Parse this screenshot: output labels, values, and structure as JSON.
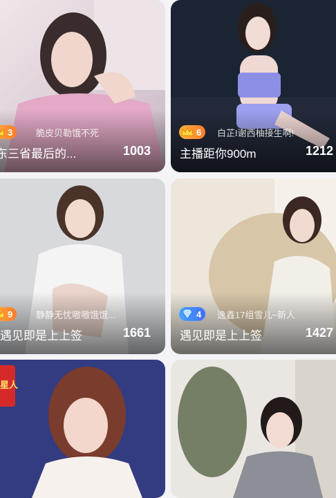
{
  "cards": [
    {
      "level": "3",
      "badge_type": "crown-icon",
      "anchor": "脆皮贝勒饿不死",
      "title": "东三省最后的...",
      "viewers": "1003"
    },
    {
      "level": "6",
      "badge_type": "crown-icon",
      "anchor": "白芷I谢西柚接生啊!",
      "title": "主播距你900m",
      "viewers": "1212"
    },
    {
      "level": "9",
      "badge_type": "crown-icon",
      "anchor": "静静无忧嗷嗷饿饿...",
      "title": "遇见即是上上签",
      "viewers": "1661"
    },
    {
      "level": "4",
      "badge_type": "diamond-icon",
      "anchor": "逸鑫17组雪儿~新人",
      "title": "遇见即是上上签",
      "viewers": "1427"
    },
    {
      "banner_text": "星人"
    },
    {}
  ],
  "colors": {
    "crown_badge": "#ff8f2c",
    "diamond_badge": "#4a8dff",
    "page_bg": "#f4f4f6"
  }
}
